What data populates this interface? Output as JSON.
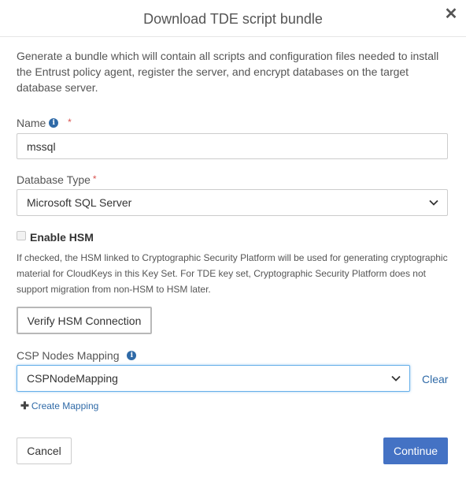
{
  "dialog": {
    "title": "Download TDE script bundle",
    "close_glyph": "✕",
    "description": "Generate a bundle which will contain all scripts and configuration files needed to install the Entrust policy agent, register the server, and encrypt databases on the target database server."
  },
  "name_field": {
    "label": "Name",
    "required_mark": "*",
    "value": "mssql",
    "info_icon": "info-icon"
  },
  "database_type": {
    "label": "Database Type",
    "required_mark": "*",
    "selected": "Microsoft SQL Server"
  },
  "hsm": {
    "checkbox_label": "Enable HSM",
    "checked": false,
    "hint": "If checked, the HSM linked to Cryptographic Security Platform will be used for generating cryptographic material for CloudKeys in this Key Set. For TDE key set, Cryptographic Security Platform does not support migration from non-HSM to HSM later.",
    "verify_button": "Verify HSM Connection"
  },
  "csp_mapping": {
    "label": "CSP Nodes Mapping",
    "selected": "CSPNodeMapping",
    "clear_link": "Clear",
    "create_link": "Create Mapping",
    "create_glyph": "✚"
  },
  "footer": {
    "cancel_label": "Cancel",
    "continue_label": "Continue"
  },
  "colors": {
    "accent": "#4472c4",
    "link": "#2f6aa7",
    "required": "#d9534f",
    "focus_border": "#66afe9"
  }
}
